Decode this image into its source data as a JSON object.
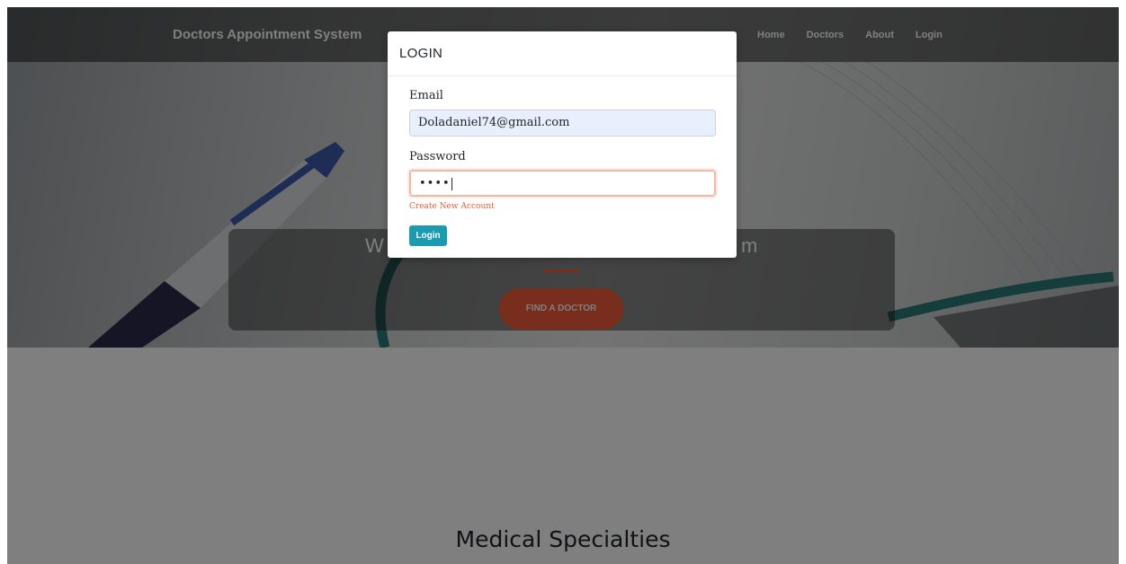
{
  "navbar": {
    "brand": "Doctors Appointment System",
    "links": [
      "Home",
      "Doctors",
      "About",
      "Login"
    ]
  },
  "hero": {
    "welcome_text_left": "W",
    "welcome_text_right": "m",
    "find_button": "FIND A DOCTOR"
  },
  "section": {
    "title": "Medical Specialties"
  },
  "login_modal": {
    "title": "LOGIN",
    "email_label": "Email",
    "email_value": "Doladaniel74@gmail.com",
    "password_label": "Password",
    "password_mask": "••••",
    "create_account_link": "Create New Account",
    "login_button": "Login"
  },
  "colors": {
    "accent_orange": "#f05a3a",
    "login_button": "#1a9bb0",
    "autofill_blue": "#e8f0fe"
  }
}
